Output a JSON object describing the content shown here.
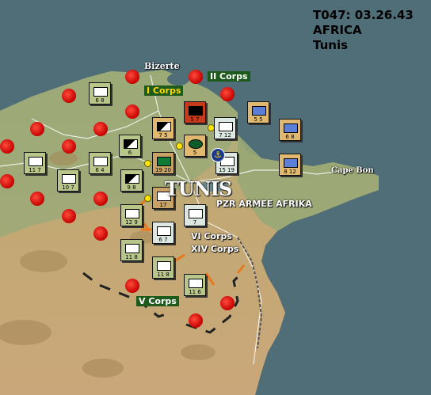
{
  "turn": {
    "line1": "T047: 03.26.43",
    "line2": "AFRICA",
    "line3": "Tunis"
  },
  "cities": {
    "bizerte": "Bizerte",
    "tunis": "TUNIS",
    "cape_bon": "Cape Bon"
  },
  "corps": {
    "i_corps": "I Corps",
    "ii_corps": "II Corps",
    "pzr_armee": "PZR ARMEE AFRIKA",
    "vi_corps": "VI Corps",
    "xiv_corps": "XIV Corps",
    "v_corps": "V Corps"
  },
  "units": [
    {
      "name": "unit-bizerte-west",
      "str": "6 8"
    },
    {
      "name": "unit-red-armor",
      "str": "5 7"
    },
    {
      "name": "unit-allied-1",
      "str": "7 5"
    },
    {
      "name": "unit-inf-1",
      "str": "7 12"
    },
    {
      "name": "unit-allied-ship-1",
      "str": "5 5"
    },
    {
      "name": "unit-allied-ship-2",
      "str": "6 8"
    },
    {
      "name": "unit-allied-ship-3",
      "str": "8 12"
    },
    {
      "name": "unit-ger-6",
      "str": "6"
    },
    {
      "name": "unit-ger-5",
      "str": "5"
    },
    {
      "name": "unit-ger-1920",
      "str": "19 20"
    },
    {
      "name": "unit-ger-1519",
      "str": "15 19"
    },
    {
      "name": "unit-ger-west-1",
      "str": "11 7"
    },
    {
      "name": "unit-ger-west-2",
      "str": "10 7"
    },
    {
      "name": "unit-ger-west-3",
      "str": "6 4"
    },
    {
      "name": "unit-ger-98",
      "str": "9 8"
    },
    {
      "name": "unit-ger-17",
      "str": "17"
    },
    {
      "name": "unit-ger-129",
      "str": "12 9"
    },
    {
      "name": "unit-ger-tunis-s",
      "str": "7"
    },
    {
      "name": "unit-ger-67",
      "str": "6 7"
    },
    {
      "name": "unit-ger-118a",
      "str": "11 8"
    },
    {
      "name": "unit-ger-118b",
      "str": "11 8"
    },
    {
      "name": "unit-ger-116",
      "str": "11 6"
    }
  ],
  "colors": {
    "sea": "#4f6e78",
    "land_green": "#8fa777",
    "desert": "#c8ad7c",
    "objective": "#c40000"
  }
}
